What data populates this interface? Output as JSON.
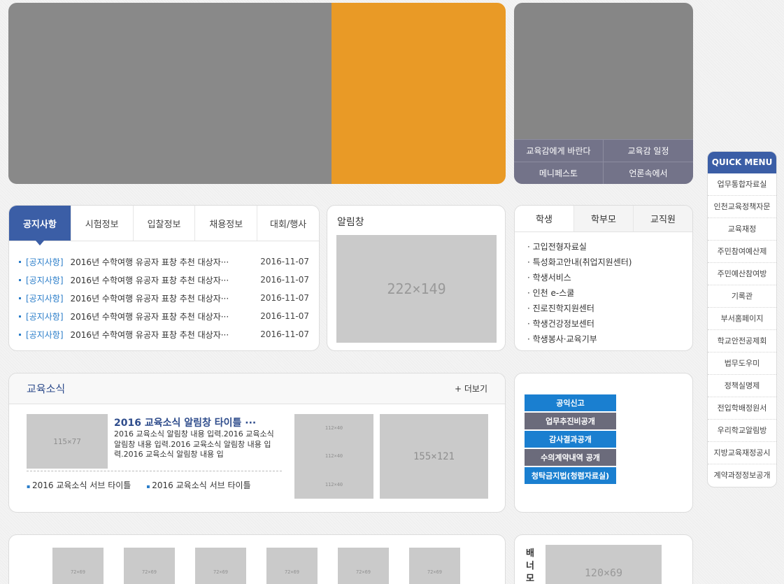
{
  "superintendent": {
    "links": [
      "교육감에게 바란다",
      "교육감 일정",
      "메니페스토",
      "언론속에서"
    ]
  },
  "board": {
    "tabs": [
      "공지사항",
      "시험정보",
      "입찰정보",
      "채용정보",
      "대회/행사"
    ],
    "items": [
      {
        "cat": "[공지사항]",
        "title": "2016년 수학여행 유공자 표창 추천 대상자···",
        "date": "2016-11-07"
      },
      {
        "cat": "[공지사항]",
        "title": "2016년 수학여행 유공자 표창 추천 대상자···",
        "date": "2016-11-07"
      },
      {
        "cat": "[공지사항]",
        "title": "2016년 수학여행 유공자 표창 추천 대상자···",
        "date": "2016-11-07"
      },
      {
        "cat": "[공지사항]",
        "title": "2016년 수학여행 유공자 표창 추천 대상자···",
        "date": "2016-11-07"
      },
      {
        "cat": "[공지사항]",
        "title": "2016년 수학여행 유공자 표창 추천 대상자···",
        "date": "2016-11-07"
      }
    ]
  },
  "alert": {
    "title": "알림창",
    "image_label": "222×149"
  },
  "group": {
    "tabs": [
      "학생",
      "학부모",
      "교직원"
    ],
    "items": [
      "고입전형자료실",
      "특성화고안내(취업지원센터)",
      "학생서비스",
      "인천 e-스쿨",
      "진로진학지원센터",
      "학생건강정보센터",
      "학생봉사·교육기부"
    ]
  },
  "quick": {
    "title": "QUICK MENU",
    "items": [
      "업무통합자료실",
      "인천교육정책자문",
      "교육재정",
      "주민참여예산제",
      "주민예산참여방",
      "기록관",
      "부서홈페이지",
      "학교안전공제회",
      "법무도우미",
      "정책실명제",
      "전입학배정원서",
      "우리학교알림방",
      "지방교육재정공시",
      "계약과정정보공개"
    ]
  },
  "news": {
    "title": "교육소식",
    "more": "+ 더보기",
    "thumb_label": "115×77",
    "item_title": "2016 교육소식 알림창 타이틀 ···",
    "item_desc": "2016 교육소식 알림창 내용 입력.2016 교육소식 알림창 내용 입력.2016 교육소식 알림창 내용 입력.2016 교육소식 알림창 내용 입",
    "subs": [
      "2016 교육소식 서브 타이틀",
      "2016 교육소식 서브 타이틀"
    ],
    "small_labels": [
      "112×40",
      "112×40",
      "112×40"
    ],
    "big_label": "155×121"
  },
  "public": {
    "buttons": [
      {
        "label": "공익신고",
        "color": "#1a7fd0"
      },
      {
        "label": "업무추진비공개",
        "color": "#6b6b7b"
      },
      {
        "label": "감사결과공개",
        "color": "#1a7fd0"
      },
      {
        "label": "수의계약내역 공개",
        "color": "#6b6b7b"
      },
      {
        "label": "청탁금지법(청렴자료실)",
        "color": "#1a7fd0"
      }
    ]
  },
  "strip": {
    "labels": [
      "72×69",
      "72×69",
      "72×69",
      "72×69",
      "72×69",
      "72×69"
    ]
  },
  "banner": {
    "label": "배너모",
    "image_label": "120×69"
  },
  "colors": {
    "accent": "#3b5ea6",
    "link": "#2a7dc9",
    "hero_gray": "#898989",
    "hero_orange": "#e99a26"
  }
}
